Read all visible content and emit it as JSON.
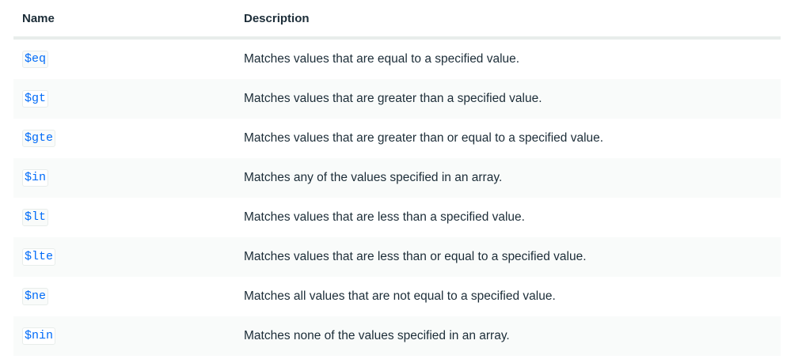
{
  "table": {
    "headers": {
      "name": "Name",
      "description": "Description"
    },
    "rows": [
      {
        "operator": "$eq",
        "description": "Matches values that are equal to a specified value."
      },
      {
        "operator": "$gt",
        "description": "Matches values that are greater than a specified value."
      },
      {
        "operator": "$gte",
        "description": "Matches values that are greater than or equal to a specified value."
      },
      {
        "operator": "$in",
        "description": "Matches any of the values specified in an array."
      },
      {
        "operator": "$lt",
        "description": "Matches values that are less than a specified value."
      },
      {
        "operator": "$lte",
        "description": "Matches values that are less than or equal to a specified value."
      },
      {
        "operator": "$ne",
        "description": "Matches all values that are not equal to a specified value."
      },
      {
        "operator": "$nin",
        "description": "Matches none of the values specified in an array."
      }
    ]
  },
  "colors": {
    "link": "#016bf8",
    "text": "#1c2d38",
    "stripe": "#f9fbfa",
    "border": "#e8edeb"
  }
}
